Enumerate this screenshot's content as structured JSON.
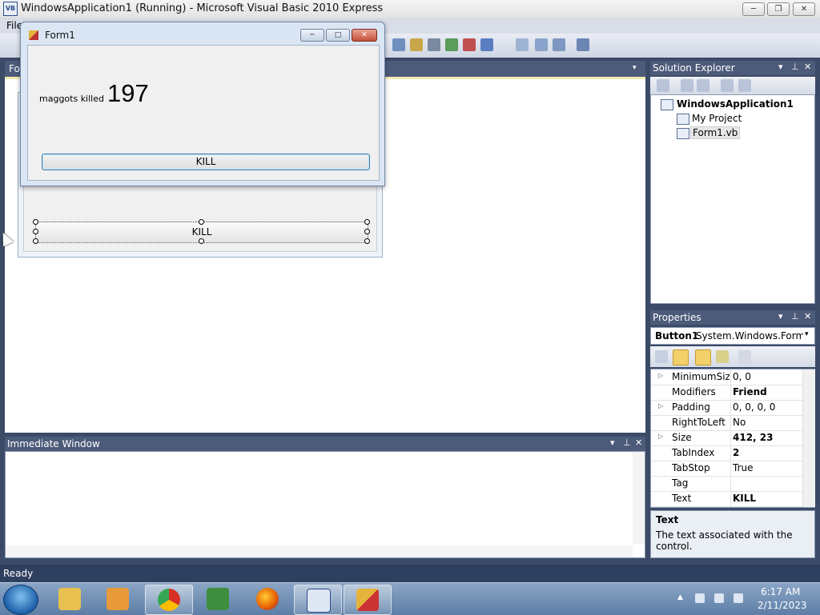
{
  "ide": {
    "title": "WindowsApplication1 (Running) - Microsoft Visual Basic 2010 Express",
    "app_icon_text": "VB",
    "menu_file": "File",
    "doc_tab_label": "Fo",
    "caption_min": "─",
    "caption_max": "❐",
    "caption_close": "✕"
  },
  "form1": {
    "title": "Form1",
    "label_text": "maggots killed",
    "count": "197",
    "button_label": "KILL",
    "min": "─",
    "max": "□",
    "close": "✕"
  },
  "designer": {
    "button_label": "KILL"
  },
  "solution_explorer": {
    "header": "Solution Explorer",
    "items": [
      {
        "label": "WindowsApplication1"
      },
      {
        "label": "My Project"
      },
      {
        "label": "Form1.vb"
      }
    ]
  },
  "properties": {
    "header": "Properties",
    "object_name": "Button1",
    "object_type": "System.Windows.Forms.E",
    "rows": [
      {
        "name": "MinimumSize",
        "value": "0, 0",
        "expandable": "▷"
      },
      {
        "name": "Modifiers",
        "value": "Friend",
        "expandable": ""
      },
      {
        "name": "Padding",
        "value": "0, 0, 0, 0",
        "expandable": "▷"
      },
      {
        "name": "RightToLeft",
        "value": "No",
        "expandable": ""
      },
      {
        "name": "Size",
        "value": "412, 23",
        "expandable": "▷"
      },
      {
        "name": "TabIndex",
        "value": "2",
        "expandable": ""
      },
      {
        "name": "TabStop",
        "value": "True",
        "expandable": ""
      },
      {
        "name": "Tag",
        "value": "",
        "expandable": ""
      },
      {
        "name": "Text",
        "value": "KILL",
        "expandable": ""
      }
    ],
    "bold_rows": [
      1,
      4,
      5,
      8
    ],
    "desc_title": "Text",
    "desc_text": "The text associated with the control."
  },
  "immediate": {
    "header": "Immediate Window"
  },
  "panel_controls": {
    "dropdown": "▾",
    "pin": "⊥",
    "close": "✕"
  },
  "statusbar": {
    "text": "Ready"
  },
  "taskbar": {
    "time": "6:17 AM",
    "date": "2/11/2023"
  }
}
